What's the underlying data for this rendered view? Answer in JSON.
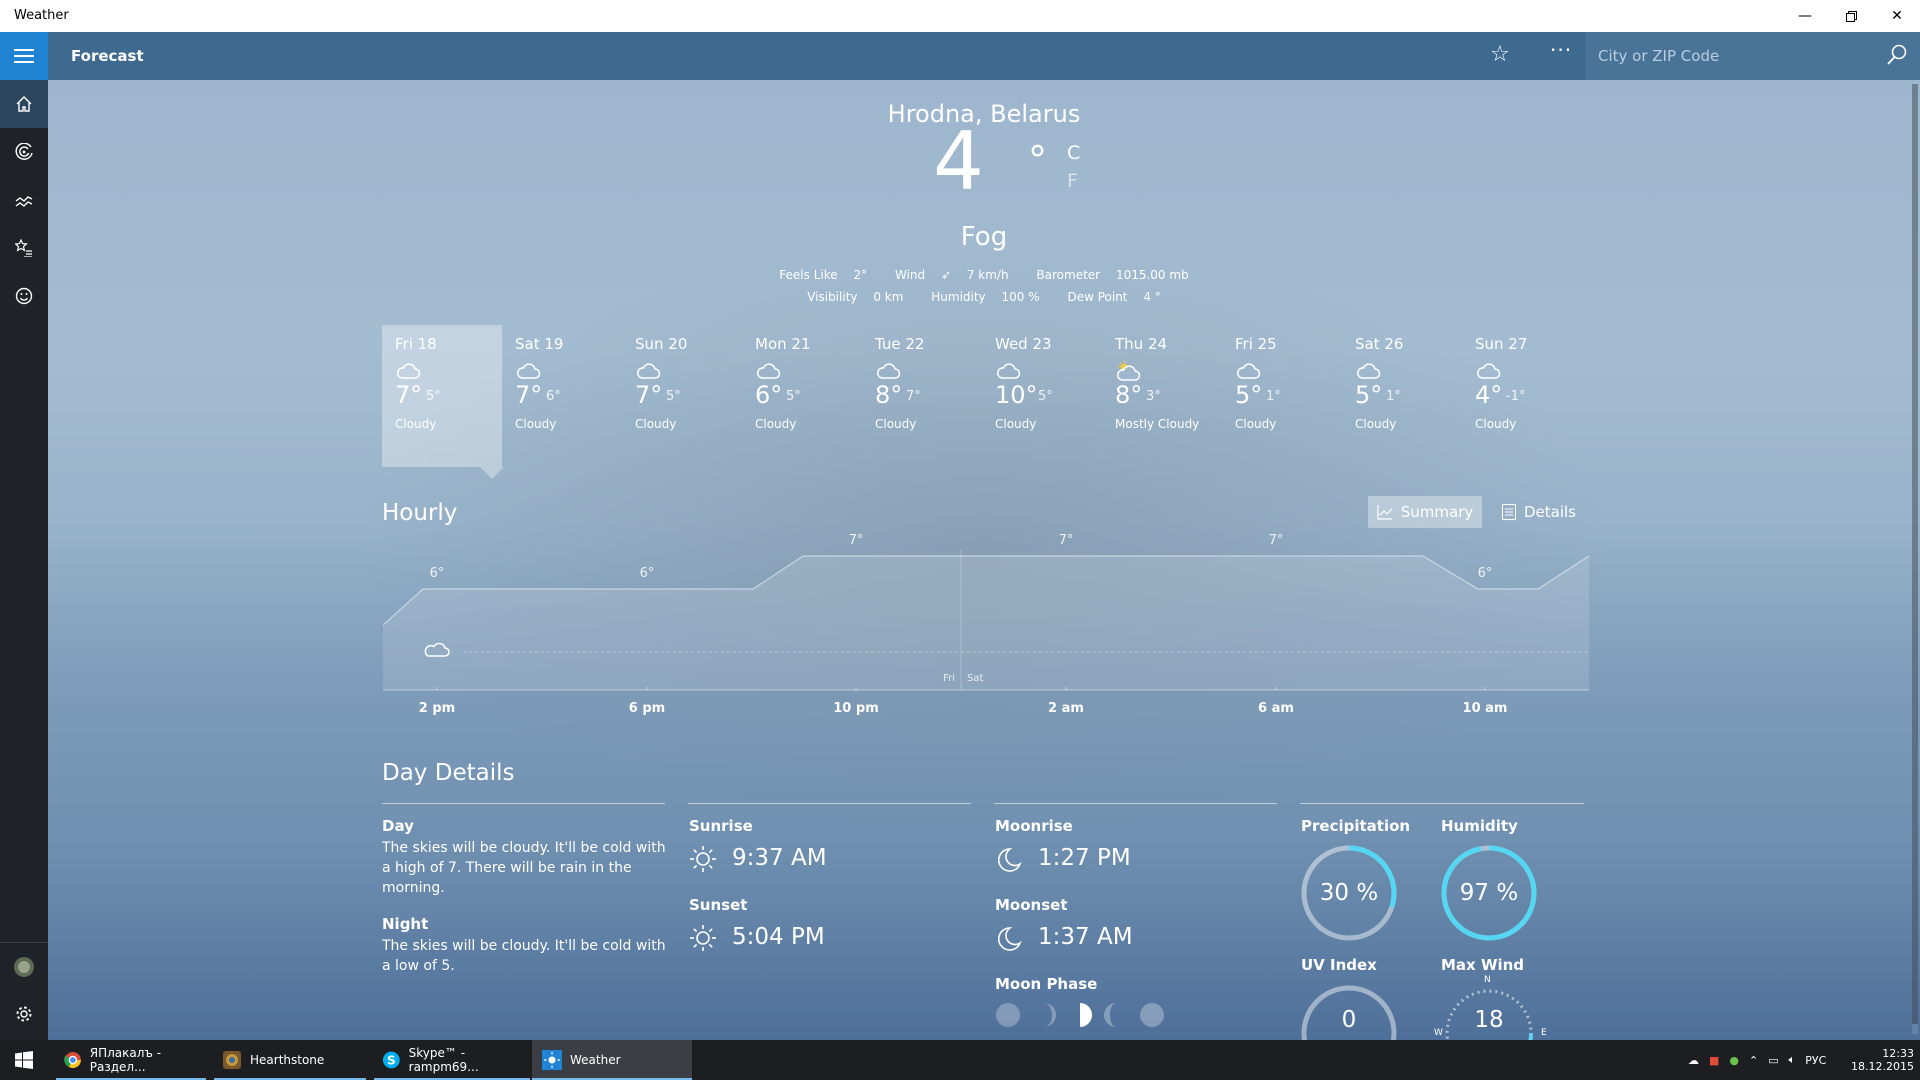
{
  "window": {
    "title": "Weather"
  },
  "appbar": {
    "title": "Forecast",
    "search_placeholder": "City or ZIP Code"
  },
  "current": {
    "location": "Hrodna, Belarus",
    "temp": "4",
    "deg": "°",
    "unit_c": "C",
    "unit_f": "F",
    "condition": "Fog",
    "feels_like_label": "Feels Like",
    "feels_like": "2°",
    "wind_label": "Wind",
    "wind": "7 km/h",
    "barometer_label": "Barometer",
    "barometer": "1015.00 mb",
    "visibility_label": "Visibility",
    "visibility": "0 km",
    "humidity_label": "Humidity",
    "humidity": "100 %",
    "dewpoint_label": "Dew Point",
    "dewpoint": "4 °"
  },
  "days": [
    {
      "name": "Fri 18",
      "hi": "7°",
      "lo": "5°",
      "desc": "Cloudy",
      "icon": "cloud-icon"
    },
    {
      "name": "Sat 19",
      "hi": "7°",
      "lo": "6°",
      "desc": "Cloudy",
      "icon": "cloud-icon"
    },
    {
      "name": "Sun 20",
      "hi": "7°",
      "lo": "5°",
      "desc": "Cloudy",
      "icon": "cloud-icon"
    },
    {
      "name": "Mon 21",
      "hi": "6°",
      "lo": "5°",
      "desc": "Cloudy",
      "icon": "cloud-icon"
    },
    {
      "name": "Tue 22",
      "hi": "8°",
      "lo": "7°",
      "desc": "Cloudy",
      "icon": "cloud-icon"
    },
    {
      "name": "Wed 23",
      "hi": "10°",
      "lo": "5°",
      "desc": "Cloudy",
      "icon": "cloud-icon"
    },
    {
      "name": "Thu 24",
      "hi": "8°",
      "lo": "3°",
      "desc": "Mostly Cloudy",
      "icon": "partly-sunny-icon"
    },
    {
      "name": "Fri 25",
      "hi": "5°",
      "lo": "1°",
      "desc": "Cloudy",
      "icon": "cloud-icon"
    },
    {
      "name": "Sat 26",
      "hi": "5°",
      "lo": "1°",
      "desc": "Cloudy",
      "icon": "cloud-icon"
    },
    {
      "name": "Sun 27",
      "hi": "4°",
      "lo": "-1°",
      "desc": "Cloudy",
      "icon": "cloud-icon"
    }
  ],
  "hourly": {
    "title": "Hourly",
    "summary_label": "Summary",
    "details_label": "Details",
    "day_left": "Fri",
    "day_right": "Sat"
  },
  "chart_data": {
    "type": "area",
    "x": [
      "2 pm",
      "6 pm",
      "10 pm",
      "2 am",
      "6 am",
      "10 am"
    ],
    "temp_labels": [
      "6°",
      "6°",
      "7°",
      "7°",
      "7°",
      "6°"
    ],
    "values": [
      6,
      6,
      7,
      7,
      7,
      6
    ],
    "xlabel": "",
    "ylabel": ""
  },
  "daydetails": {
    "title": "Day Details",
    "day_label": "Day",
    "day_text": "The skies will be cloudy. It'll be cold with a high of 7. There will be rain in the morning.",
    "night_label": "Night",
    "night_text": "The skies will be cloudy. It'll be cold with a low of 5.",
    "sunrise_label": "Sunrise",
    "sunrise": "9:37 AM",
    "sunset_label": "Sunset",
    "sunset": "5:04 PM",
    "moonrise_label": "Moonrise",
    "moonrise": "1:27 PM",
    "moonset_label": "Moonset",
    "moonset": "1:37 AM",
    "moonphase_label": "Moon Phase",
    "precip_label": "Precipitation",
    "precip": "30 %",
    "precip_pct": 30,
    "humidity_label": "Humidity",
    "humidity": "97 %",
    "humidity_pct": 97,
    "uv_label": "UV Index",
    "uv": "0",
    "wind_label": "Max Wind",
    "wind": "18",
    "compass_n": "N",
    "compass_w": "W",
    "compass_e": "E"
  },
  "taskbar": {
    "items": [
      {
        "label": "ЯПлакалъ - Раздел...",
        "icon": "chrome-icon"
      },
      {
        "label": "Hearthstone",
        "icon": "hearthstone-icon"
      },
      {
        "label": "Skype™ - rampm69...",
        "icon": "skype-icon"
      },
      {
        "label": "Weather",
        "icon": "weather-sun-icon"
      }
    ],
    "lang": "РУС",
    "time": "12:33",
    "date": "18.12.2015"
  },
  "colors": {
    "accent": "#1f84d4",
    "appbar": "#3e6a90",
    "sidebar": "#1f2226",
    "taskbar": "#1c1e22"
  }
}
